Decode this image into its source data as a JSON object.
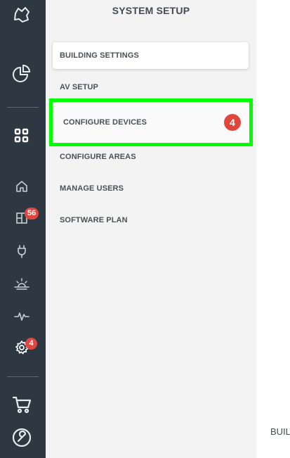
{
  "rail": {
    "badges": {
      "buildings_count": "56",
      "settings_count": "4"
    },
    "icons": [
      "logo-icon",
      "pie-chart-icon",
      "grid-icon",
      "home-icon",
      "building-icon",
      "plug-icon",
      "sunrise-icon",
      "activity-icon",
      "gear-icon",
      "cart-icon",
      "wrench-icon"
    ]
  },
  "panel": {
    "title": "SYSTEM SETUP",
    "items": [
      {
        "label": "BUILDING SETTINGS"
      },
      {
        "label": "AV SETUP"
      },
      {
        "label": "CONFIGURE DEVICES",
        "badge": "4"
      },
      {
        "label": "CONFIGURE AREAS"
      },
      {
        "label": "MANAGE USERS"
      },
      {
        "label": "SOFTWARE PLAN"
      }
    ]
  },
  "main": {
    "label": "BUIL"
  },
  "colors": {
    "rail_bg": "#2e3842",
    "badge": "#e0463e",
    "highlight": "#00ff00",
    "panel_bg": "#f3f3f3"
  }
}
